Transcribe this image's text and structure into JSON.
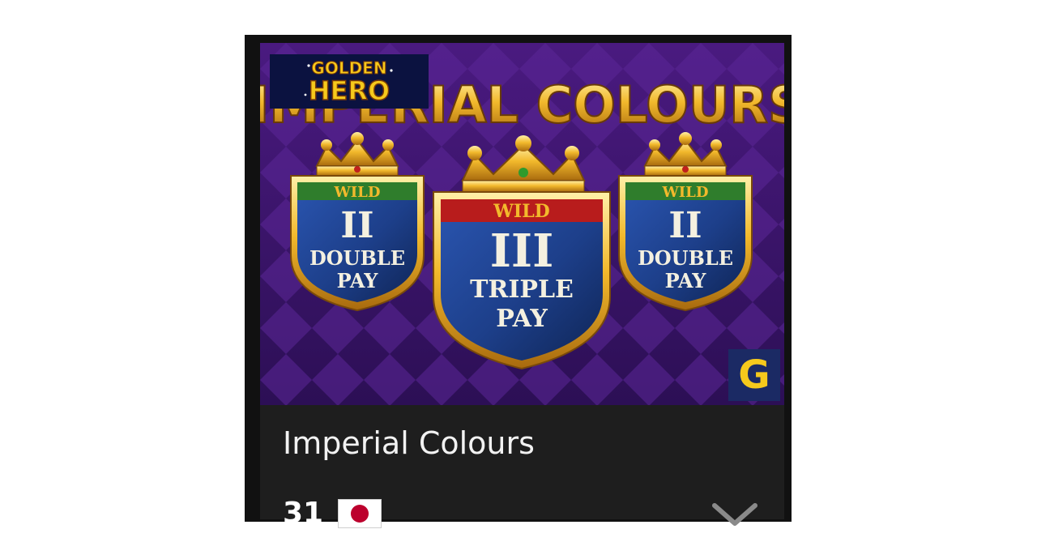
{
  "card": {
    "title": "Imperial Colours",
    "count": "31",
    "flag": "japan-flag",
    "expand_icon": "chevron-down-icon"
  },
  "thumbnail": {
    "banner_text": "IMPERIAL COLOURS",
    "brand_logo": {
      "line1": "GOLDEN",
      "line2": "HERO"
    },
    "provider_badge": "G",
    "shields": [
      {
        "wild": "WILD",
        "numeral": "II",
        "line1": "DOUBLE",
        "line2": "PAY"
      },
      {
        "wild": "WILD",
        "numeral": "III",
        "line1": "TRIPLE",
        "line2": "PAY"
      },
      {
        "wild": "WILD",
        "numeral": "II",
        "line1": "DOUBLE",
        "line2": "PAY"
      }
    ]
  },
  "colors": {
    "card_border": "#111111",
    "info_bg": "#1e1e1e",
    "thumb_purple": "#3d1670",
    "gold": "#f2b92c",
    "shield_blue": "#1d3f8a",
    "wild_green": "#2f7d2c",
    "wild_red": "#b81c1c",
    "flag_red": "#bc002d"
  }
}
